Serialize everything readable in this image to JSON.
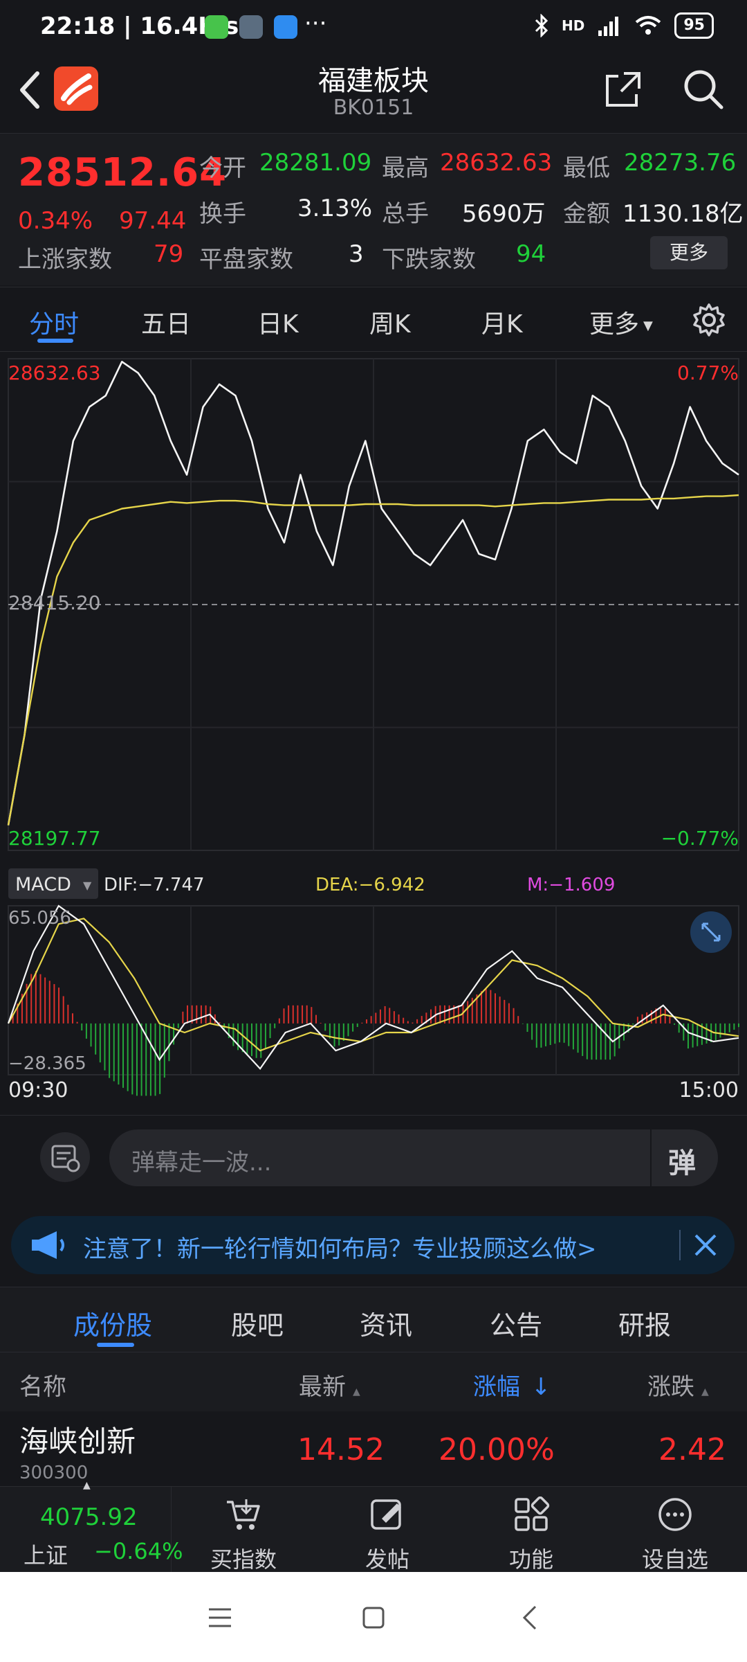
{
  "status_bar": {
    "time_speed": "22:18 | 16.4K/s",
    "more": "···",
    "network": "HD",
    "battery": "95"
  },
  "header": {
    "title": "福建板块",
    "code": "BK0151"
  },
  "quote": {
    "price": "28512.64",
    "change_pct": "0.34%",
    "change": "97.44",
    "open_label": "今开",
    "open": "28281.09",
    "high_label": "最高",
    "high": "28632.63",
    "low_label": "最低",
    "low": "28273.76",
    "turnover_label": "换手",
    "turnover": "3.13%",
    "volume_label": "总手",
    "volume": "5690万",
    "amount_label": "金额",
    "amount": "1130.18亿",
    "up_label": "上涨家数",
    "up": "79",
    "flat_label": "平盘家数",
    "flat": "3",
    "down_label": "下跌家数",
    "down": "94",
    "more_label": "更多"
  },
  "chart_tabs": [
    "分时",
    "五日",
    "日K",
    "周K",
    "月K",
    "更多"
  ],
  "chart_data": [
    {
      "type": "line",
      "title": "分时",
      "x": [
        "09:30",
        "15:00"
      ],
      "ylim": [
        28197.77,
        28632.63
      ],
      "y_labels": {
        "top": "28632.63",
        "mid": "28415.20",
        "bottom": "28197.77"
      },
      "pct_labels": {
        "top": "0.77%",
        "bottom": "−0.77%"
      },
      "series": [
        {
          "values": [
            28220,
            28300,
            28420,
            28480,
            28560,
            28590,
            28600,
            28630,
            28620,
            28600,
            28560,
            28530,
            28590,
            28610,
            28600,
            28560,
            28500,
            28470,
            28530,
            28480,
            28450,
            28520,
            28560,
            28500,
            28480,
            28460,
            28450,
            28470,
            28490,
            28460,
            28455,
            28500,
            28560,
            28570,
            28550,
            28540,
            28600,
            28590,
            28560,
            28520,
            28500,
            28540,
            28590,
            28560,
            28540,
            28530
          ]
        },
        {
          "values": [
            28220,
            28300,
            28380,
            28440,
            28470,
            28490,
            28495,
            28500,
            28502,
            28504,
            28506,
            28505,
            28506,
            28507,
            28507,
            28506,
            28504,
            28503,
            28503,
            28503,
            28503,
            28503,
            28504,
            28504,
            28504,
            28503,
            28503,
            28503,
            28503,
            28503,
            28502,
            28503,
            28504,
            28505,
            28505,
            28506,
            28507,
            28508,
            28508,
            28508,
            28509,
            28509,
            28510,
            28511,
            28511,
            28512
          ]
        }
      ]
    },
    {
      "type": "line",
      "title": "MACD",
      "indicator": "MACD",
      "dif_label": "DIF:−7.747",
      "dea_label": "DEA:−6.942",
      "m_label": "M:−1.609",
      "ylim": [
        -28.365,
        65.056
      ],
      "y_labels": {
        "top": "65.056",
        "bottom": "−28.365"
      },
      "x_labels": [
        "09:30",
        "15:00"
      ],
      "series": [
        {
          "name": "DIF",
          "values": [
            0,
            40,
            65,
            55,
            30,
            5,
            -20,
            0,
            5,
            -10,
            -25,
            -5,
            0,
            -15,
            -10,
            0,
            -5,
            5,
            10,
            30,
            40,
            25,
            20,
            5,
            -10,
            0,
            10,
            -5,
            -10,
            -8
          ]
        },
        {
          "name": "DEA",
          "values": [
            0,
            25,
            55,
            58,
            45,
            25,
            0,
            -5,
            0,
            -3,
            -15,
            -10,
            -5,
            -8,
            -10,
            -5,
            -5,
            0,
            5,
            20,
            35,
            32,
            25,
            15,
            0,
            -2,
            5,
            2,
            -5,
            -7
          ]
        }
      ]
    }
  ],
  "danmu": {
    "placeholder": "弹幕走一波...",
    "btn": "弹"
  },
  "notice": {
    "text": "注意了！新一轮行情如何布局？专业投顾这么做>"
  },
  "sub_tabs": [
    "成份股",
    "股吧",
    "资讯",
    "公告",
    "研报"
  ],
  "table": {
    "headers": {
      "name": "名称",
      "latest": "最新",
      "pct": "涨幅",
      "change": "涨跌"
    },
    "rows": [
      {
        "name": "海峡创新",
        "code": "300300",
        "latest": "14.52",
        "pct": "20.00%",
        "change": "2.42"
      }
    ]
  },
  "bottom_nav": {
    "index_value": "4075.92",
    "index_name": "上证",
    "index_change": "−0.64%",
    "items": [
      "买指数",
      "发帖",
      "功能",
      "设自选"
    ]
  },
  "colors": {
    "up": "#ff2e2e",
    "down": "#1fd13a",
    "accent": "#3d8bff",
    "avg_line": "#e6d54a"
  }
}
